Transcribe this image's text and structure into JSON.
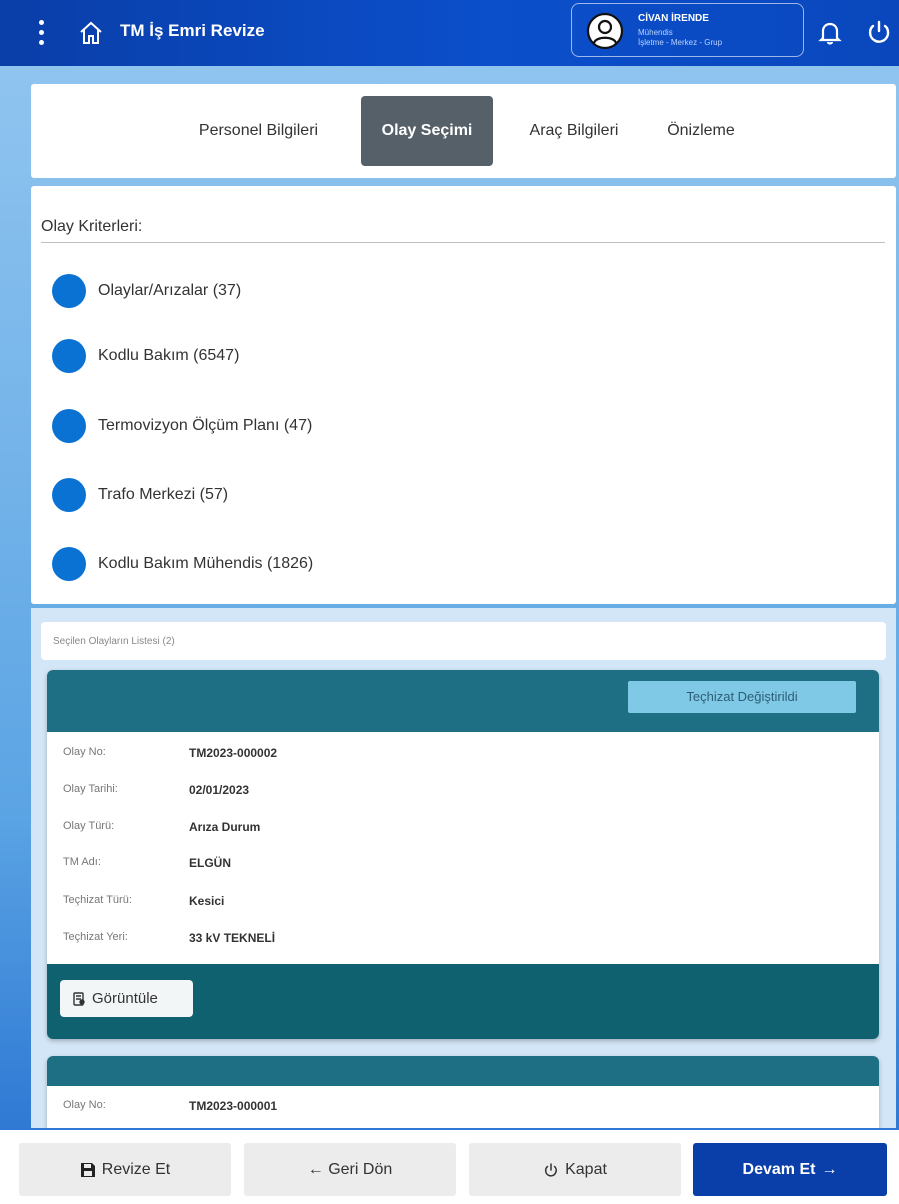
{
  "header": {
    "title": "TM İş Emri Revize",
    "user": {
      "name": "CİVAN İRENDE",
      "role": "Mühendis",
      "unit": "İşletme - Merkez - Grup"
    }
  },
  "tabs": [
    {
      "label": "Personel Bilgileri",
      "active": false
    },
    {
      "label": "Olay Seçimi",
      "active": true
    },
    {
      "label": "Araç Bilgileri",
      "active": false
    },
    {
      "label": "Önizleme",
      "active": false
    }
  ],
  "criteria": {
    "title": "Olay Kriterleri:",
    "options": [
      {
        "label": "Olaylar/Arızalar (37)"
      },
      {
        "label": "Kodlu Bakım (6547)"
      },
      {
        "label": "Termovizyon Ölçüm Planı (47)"
      },
      {
        "label": "Trafo Merkezi (57)"
      },
      {
        "label": "Kodlu Bakım Mühendis (1826)"
      }
    ]
  },
  "selected_list": {
    "header": "Seçilen Olayların Listesi (2)",
    "cards": [
      {
        "status": "Teçhizat Değiştirildi",
        "fields": [
          {
            "label": "Olay No:",
            "value": "TM2023-000002"
          },
          {
            "label": "Olay Tarihi:",
            "value": "02/01/2023"
          },
          {
            "label": "Olay Türü:",
            "value": "Arıza Durum"
          },
          {
            "label": "TM Adı:",
            "value": "ELGÜN"
          },
          {
            "label": "Teçhizat Türü:",
            "value": "Kesici"
          },
          {
            "label": "Teçhizat Yeri:",
            "value": "33 kV TEKNELİ"
          }
        ],
        "view_label": "Görüntüle"
      },
      {
        "fields": [
          {
            "label": "Olay No:",
            "value": "TM2023-000001"
          }
        ]
      }
    ]
  },
  "footer": {
    "revise_label": "Revize Et",
    "back_label": "← Geri Dön",
    "close_label": "Kapat",
    "continue_label": "Devam Et"
  },
  "colors": {
    "header_blue": "#0a3ea8",
    "radio_blue": "#0a72d3",
    "active_tab": "#566069",
    "card_head": "#1e6f84",
    "card_foot": "#0f6170",
    "status_chip": "#7fc8e6"
  },
  "icons": {
    "menu": "kebab-menu-icon",
    "home": "home-icon",
    "avatar": "user-avatar-icon",
    "notifications": "bell-icon",
    "logout": "power-icon",
    "view": "document-icon",
    "save": "save-icon",
    "close": "power-icon"
  }
}
